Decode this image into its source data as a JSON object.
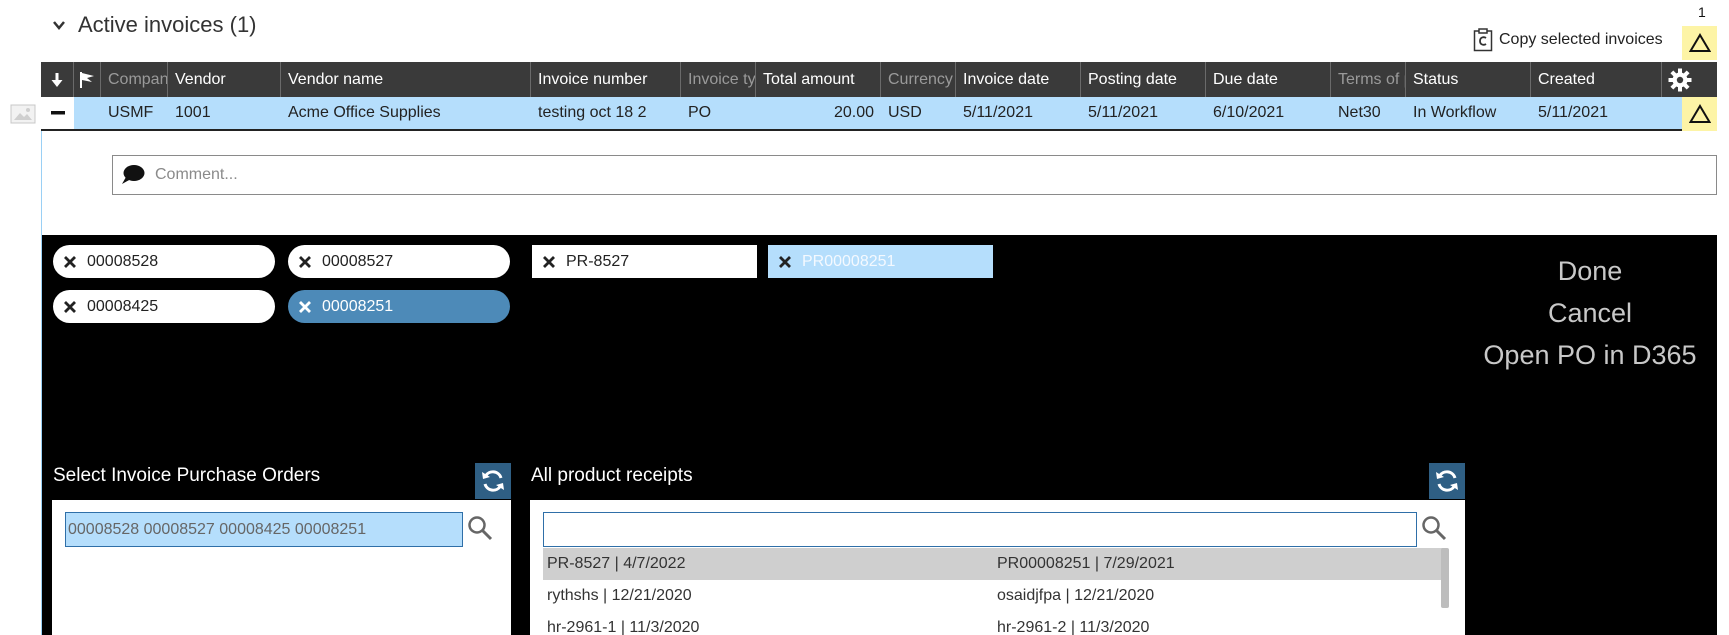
{
  "section": {
    "title": "Active invoices (1)"
  },
  "toolbar": {
    "count": "1",
    "copy_label": "Copy selected invoices"
  },
  "grid": {
    "columns": [
      "Company",
      "Vendor",
      "Vendor name",
      "Invoice number",
      "Invoice type",
      "Total amount",
      "Currency",
      "Invoice date",
      "Posting date",
      "Due date",
      "Terms of payment",
      "Status",
      "Created"
    ],
    "row": {
      "company": "USMF",
      "vendor": "1001",
      "vendor_name": "Acme Office Supplies",
      "invoice_number": "testing oct 18 2",
      "invoice_type": "PO",
      "total_amount": "20.00",
      "currency": "USD",
      "invoice_date": "5/11/2021",
      "posting_date": "5/11/2021",
      "due_date": "6/10/2021",
      "terms": "Net30",
      "status": "In Workflow",
      "created": "5/11/2021"
    }
  },
  "comment": {
    "placeholder": "Comment..."
  },
  "po_chips": [
    {
      "label": "00008528",
      "selected": false
    },
    {
      "label": "00008527",
      "selected": false
    },
    {
      "label": "00008425",
      "selected": false
    },
    {
      "label": "00008251",
      "selected": true
    }
  ],
  "pr_chips": [
    {
      "label": "PR-8527",
      "selected": false
    },
    {
      "label": "PR00008251",
      "selected": true
    }
  ],
  "actions": {
    "done": "Done",
    "cancel": "Cancel",
    "open_po": "Open PO in D365"
  },
  "po_panel": {
    "title": "Select Invoice Purchase Orders",
    "search_value": "00008528 00008527 00008425 00008251"
  },
  "pr_panel": {
    "title": "All product receipts",
    "search_value": "",
    "rows": [
      [
        "PR-8527 | 4/7/2022",
        "PR00008251 | 7/29/2021"
      ],
      [
        "rythshs | 12/21/2020",
        "osaidjfpa | 12/21/2020"
      ],
      [
        "hr-2961-1 | 11/3/2020",
        "hr-2961-2 | 11/3/2020"
      ]
    ]
  },
  "colors": {
    "header_bg": "#3a3a3a",
    "row_selected": "#b5defc",
    "warning": "#fdf4a6",
    "chip_selected": "#4d8ab8",
    "refresh": "#2f5f84"
  }
}
